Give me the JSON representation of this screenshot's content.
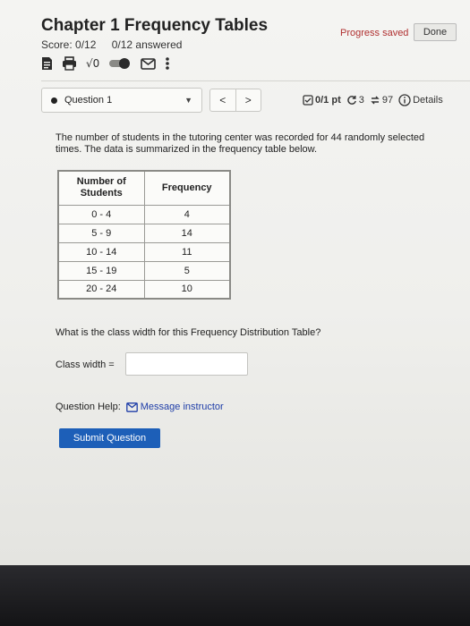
{
  "header": {
    "title": "Chapter 1 Frequency Tables",
    "progress_saved": "Progress saved",
    "done_label": "Done",
    "score": "Score: 0/12",
    "answered": "0/12 answered"
  },
  "toolbar": {
    "icons": [
      "document-icon",
      "print-icon",
      "sqrt-icon",
      "toggle-icon",
      "mail-icon",
      "more-icon"
    ],
    "sqrt_label": "√0"
  },
  "question_nav": {
    "selected": "Question 1",
    "prev": "<",
    "next": ">",
    "points": "0/1 pt",
    "retries": "3",
    "attempts": "97",
    "details": "Details"
  },
  "question": {
    "prompt": "The number of students in the tutoring center was recorded for 44 randomly selected times. The data is summarized in the frequency table below.",
    "table": {
      "headers": [
        "Number of Students",
        "Frequency"
      ],
      "rows": [
        [
          "0 - 4",
          "4"
        ],
        [
          "5 - 9",
          "14"
        ],
        [
          "10 - 14",
          "11"
        ],
        [
          "15 - 19",
          "5"
        ],
        [
          "20 - 24",
          "10"
        ]
      ]
    },
    "class_width_question": "What is the class width for this Frequency Distribution Table?",
    "class_width_label": "Class width =",
    "class_width_value": ""
  },
  "help": {
    "label": "Question Help:",
    "message_instructor": "Message instructor"
  },
  "submit_label": "Submit Question",
  "colors": {
    "accent": "#1d5fb8",
    "progress_saved": "#b03030",
    "link": "#1f3ea8"
  }
}
